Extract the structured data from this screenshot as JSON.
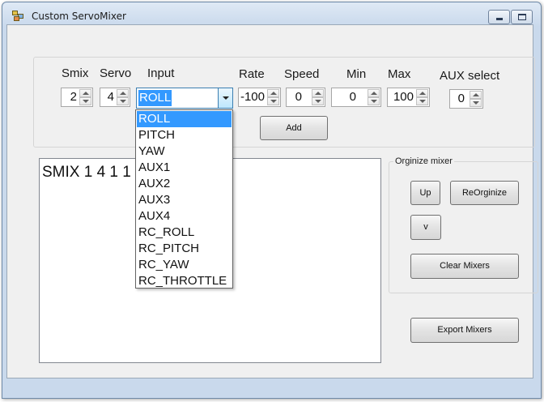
{
  "window": {
    "title": "Custom ServoMixer"
  },
  "labels": {
    "smix": "Smix",
    "servo": "Servo",
    "input": "Input",
    "rate": "Rate",
    "speed": "Speed",
    "min": "Min",
    "max": "Max",
    "aux_select": "AUX select"
  },
  "values": {
    "smix": "2",
    "servo": "4",
    "input": "ROLL",
    "rate": "-100",
    "speed": "0",
    "min": "0",
    "max": "100",
    "aux_select": "0"
  },
  "buttons": {
    "add": "Add",
    "up": "Up",
    "reorginize": "ReOrginize",
    "down": "v",
    "clear_mixers": "Clear Mixers",
    "export_mixers": "Export Mixers"
  },
  "organize_group": {
    "title": "Orginize mixer"
  },
  "mixer_text": "SMIX 1 4 1 1                0",
  "input_options": [
    "ROLL",
    "PITCH",
    "YAW",
    "AUX1",
    "AUX2",
    "AUX3",
    "AUX4",
    "RC_ROLL",
    "RC_PITCH",
    "RC_YAW",
    "RC_THROTTLE"
  ],
  "selected_option_index": 0
}
